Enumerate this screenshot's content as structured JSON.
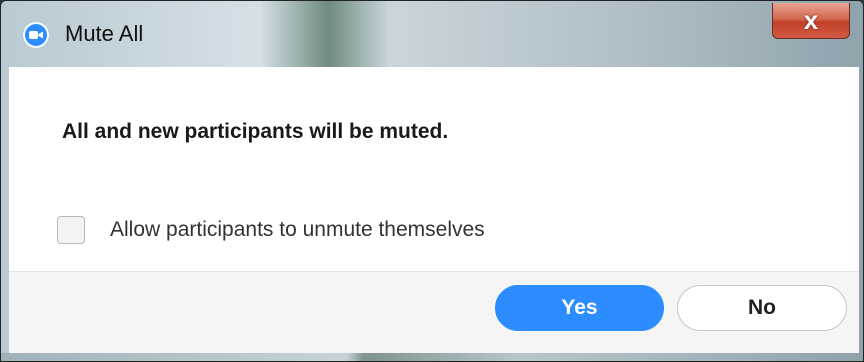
{
  "window": {
    "title": "Mute All",
    "close_glyph": "x",
    "app_icon": "zoom-camera-icon"
  },
  "dialog": {
    "message": "All and new participants will be muted.",
    "checkbox": {
      "label": "Allow participants to unmute themselves",
      "checked": false
    }
  },
  "buttons": {
    "yes_label": "Yes",
    "no_label": "No"
  },
  "colors": {
    "accent": "#2d8cff",
    "close_button": "#c7452f"
  }
}
